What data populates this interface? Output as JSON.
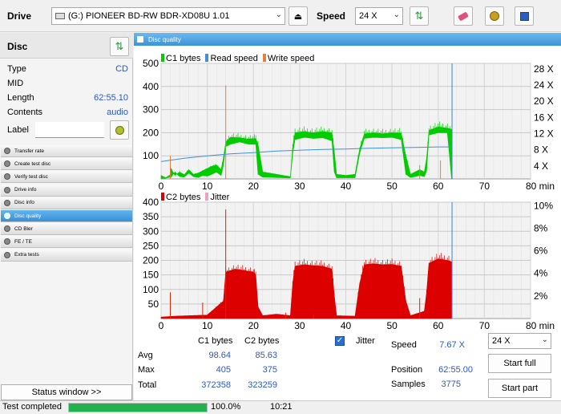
{
  "toolbar": {
    "drive_label": "Drive",
    "drive_value": "(G:)   PIONEER BD-RW   BDR-XD08U 1.01",
    "speed_label": "Speed",
    "speed_value": "24 X"
  },
  "disc": {
    "header": "Disc",
    "fields": [
      {
        "label": "Type",
        "value": "CD"
      },
      {
        "label": "MID",
        "value": ""
      },
      {
        "label": "Length",
        "value": "62:55.10"
      },
      {
        "label": "Contents",
        "value": "audio"
      },
      {
        "label": "Label",
        "value": ""
      }
    ]
  },
  "menu": [
    {
      "label": "Transfer rate",
      "active": false
    },
    {
      "label": "Create test disc",
      "active": false
    },
    {
      "label": "Verify test disc",
      "active": false
    },
    {
      "label": "Drive info",
      "active": false
    },
    {
      "label": "Disc info",
      "active": false
    },
    {
      "label": "Disc quality",
      "active": true
    },
    {
      "label": "CD Bler",
      "active": false
    },
    {
      "label": "FE / TE",
      "active": false
    },
    {
      "label": "Extra tests",
      "active": false
    }
  ],
  "status_window_label": "Status window >>",
  "panel_title": "Disc quality",
  "chart_data": [
    {
      "type": "area",
      "legend": [
        "C1 bytes",
        "Read speed",
        "Write speed"
      ],
      "x_ticks": [
        "0",
        "10",
        "20",
        "30",
        "40",
        "50",
        "60",
        "70",
        "80 min"
      ],
      "y_left_ticks": [
        "500",
        "400",
        "300",
        "200",
        "100"
      ],
      "y_right_ticks": [
        "28 X",
        "24 X",
        "20 X",
        "16 X",
        "12 X",
        "8 X",
        "4 X"
      ],
      "xlim": [
        0,
        80
      ],
      "ylim": [
        0,
        500
      ],
      "series": [
        {
          "name": "C1 bytes",
          "color": "#00cc00",
          "segments": [
            [
              0,
              1,
              15
            ],
            [
              1,
              3,
              5
            ],
            [
              2,
              8,
              18
            ],
            [
              2,
              50,
              3
            ],
            [
              3,
              15,
              30
            ],
            [
              4,
              30,
              10
            ],
            [
              5,
              18,
              8
            ],
            [
              6,
              40,
              25
            ],
            [
              7,
              20,
              10
            ],
            [
              8,
              25,
              6
            ],
            [
              9,
              35,
              15
            ],
            [
              10,
              45,
              12
            ],
            [
              11,
              55,
              20
            ],
            [
              12,
              60,
              30
            ],
            [
              13,
              40,
              15
            ],
            [
              13.5,
              90,
              60
            ],
            [
              14,
              160,
              140
            ],
            [
              15,
              180,
              150
            ],
            [
              17,
              178,
              160
            ],
            [
              19,
              172,
              150
            ],
            [
              20.5,
              175,
              150
            ],
            [
              21,
              150,
              20
            ],
            [
              22,
              30,
              8
            ],
            [
              25,
              20,
              6
            ],
            [
              28,
              10,
              4
            ],
            [
              28.5,
              140,
              110
            ],
            [
              29,
              200,
              170
            ],
            [
              31,
              205,
              180
            ],
            [
              33,
              200,
              175
            ],
            [
              35,
              205,
              178
            ],
            [
              37,
              200,
              165
            ],
            [
              37.5,
              120,
              30
            ],
            [
              38,
              20,
              5
            ],
            [
              40,
              15,
              5
            ],
            [
              42,
              20,
              5
            ],
            [
              43,
              130,
              110
            ],
            [
              44,
              195,
              175
            ],
            [
              46,
              200,
              180
            ],
            [
              48,
              195,
              178
            ],
            [
              50,
              200,
              180
            ],
            [
              52,
              198,
              170
            ],
            [
              53,
              100,
              20
            ],
            [
              54,
              20,
              6
            ],
            [
              56,
              40,
              15
            ],
            [
              57,
              30,
              10
            ],
            [
              57.5,
              90,
              35
            ],
            [
              58,
              210,
              190
            ],
            [
              60,
              225,
              200
            ],
            [
              62,
              220,
              200
            ],
            [
              62.9,
              215,
              0
            ]
          ]
        },
        {
          "name": "Read speed",
          "color": "#3d8fde",
          "points": [
            [
              0,
              4.3
            ],
            [
              5,
              5.1
            ],
            [
              10,
              5.7
            ],
            [
              15,
              6.2
            ],
            [
              20,
              6.5
            ],
            [
              25,
              6.9
            ],
            [
              30,
              7.1
            ],
            [
              35,
              7.3
            ],
            [
              40,
              7.4
            ],
            [
              45,
              7.6
            ],
            [
              50,
              7.7
            ],
            [
              55,
              7.8
            ],
            [
              60,
              7.9
            ],
            [
              63,
              7.9
            ]
          ]
        }
      ],
      "spikes": [
        [
          14,
          405
        ],
        [
          2,
          100
        ],
        [
          60.5,
          80
        ],
        [
          56,
          60
        ]
      ],
      "cursor_x": 63
    },
    {
      "type": "area",
      "legend": [
        "C2 bytes",
        "Jitter"
      ],
      "x_ticks": [
        "0",
        "10",
        "20",
        "30",
        "40",
        "50",
        "60",
        "70",
        "80 min"
      ],
      "y_left_ticks": [
        "400",
        "350",
        "300",
        "250",
        "200",
        "150",
        "100",
        "50"
      ],
      "y_right_ticks": [
        "10%",
        "8%",
        "6%",
        "4%",
        "2%"
      ],
      "xlim": [
        0,
        80
      ],
      "ylim": [
        0,
        400
      ],
      "series": [
        {
          "name": "C2 bytes",
          "color": "#dd0000",
          "segments": [
            [
              0,
              5,
              0
            ],
            [
              3,
              8,
              0
            ],
            [
              6,
              10,
              0
            ],
            [
              10,
              12,
              0
            ],
            [
              13.5,
              60,
              0
            ],
            [
              14,
              160,
              0
            ],
            [
              16,
              170,
              0
            ],
            [
              18,
              165,
              0
            ],
            [
              20,
              160,
              0
            ],
            [
              20.5,
              150,
              0
            ],
            [
              21,
              40,
              0
            ],
            [
              22,
              10,
              0
            ],
            [
              25,
              15,
              0
            ],
            [
              28,
              10,
              0
            ],
            [
              28.5,
              120,
              0
            ],
            [
              29,
              180,
              0
            ],
            [
              31,
              185,
              0
            ],
            [
              33,
              182,
              0
            ],
            [
              35,
              180,
              0
            ],
            [
              37,
              170,
              0
            ],
            [
              37.5,
              80,
              0
            ],
            [
              38,
              10,
              0
            ],
            [
              42,
              8,
              0
            ],
            [
              43,
              120,
              0
            ],
            [
              44,
              185,
              0
            ],
            [
              46,
              188,
              0
            ],
            [
              48,
              185,
              0
            ],
            [
              50,
              186,
              0
            ],
            [
              52,
              180,
              0
            ],
            [
              53,
              60,
              0
            ],
            [
              54,
              10,
              0
            ],
            [
              57,
              25,
              0
            ],
            [
              57.5,
              90,
              0
            ],
            [
              58,
              190,
              0
            ],
            [
              60,
              205,
              0
            ],
            [
              62,
              200,
              0
            ],
            [
              62.9,
              195,
              0
            ]
          ]
        }
      ],
      "spikes": [
        [
          14,
          375
        ],
        [
          2,
          90
        ],
        [
          9,
          55
        ],
        [
          27,
          20
        ],
        [
          33,
          15
        ],
        [
          56,
          70
        ]
      ],
      "cursor_x": 63
    }
  ],
  "stats": {
    "col_c1": "C1 bytes",
    "col_c2": "C2 bytes",
    "jitter_label": "Jitter",
    "rows": [
      {
        "label": "Avg",
        "c1": "98.64",
        "c2": "85.63"
      },
      {
        "label": "Max",
        "c1": "405",
        "c2": "375"
      },
      {
        "label": "Total",
        "c1": "372358",
        "c2": "323259"
      }
    ],
    "speed_label": "Speed",
    "speed_value": "7.67 X",
    "position_label": "Position",
    "position_value": "62:55.00",
    "samples_label": "Samples",
    "samples_value": "3775",
    "speed_select": "24 X",
    "start_full": "Start full",
    "start_part": "Start part"
  },
  "status": {
    "text": "Test completed",
    "progress_value": 100,
    "progress_text": "100.0%",
    "time": "10:21"
  },
  "colors": {
    "accent": "#3d93d8",
    "c1": "#00cc00",
    "c2": "#dd0000",
    "progress": "#22b14c"
  }
}
